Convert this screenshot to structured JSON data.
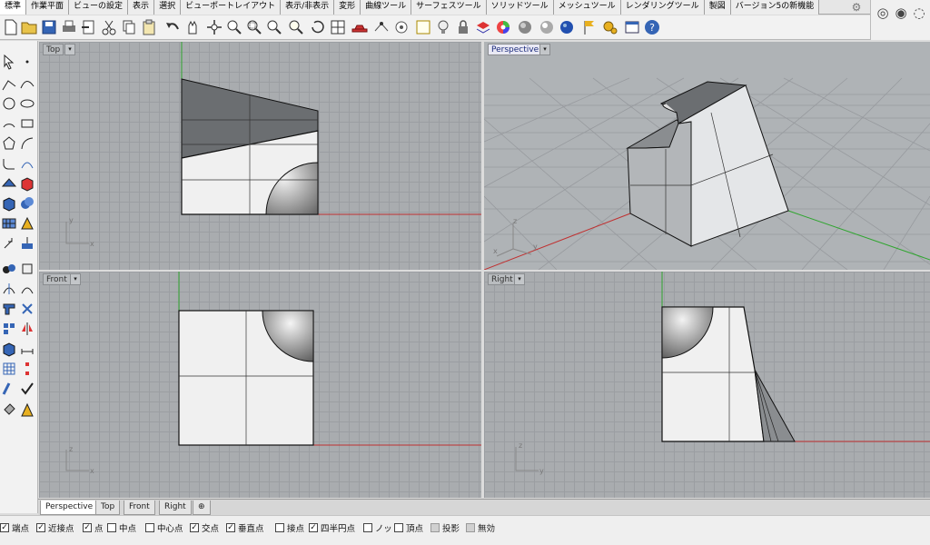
{
  "ribbon_tabs": [
    "標準",
    "作業平面",
    "ビューの設定",
    "表示",
    "選択",
    "ビューポートレイアウト",
    "表示/非表示",
    "変形",
    "曲線ツール",
    "サーフェスツール",
    "ソリッドツール",
    "メッシュツール",
    "レンダリングツール",
    "製図",
    "バージョン5の新機能"
  ],
  "viewports": {
    "top": {
      "title": "Top",
      "menu": "▾",
      "axis_labels": [
        "y",
        "x"
      ]
    },
    "perspective": {
      "title": "Perspective",
      "menu": "▾",
      "axis_labels": [
        "z",
        "y",
        "x"
      ]
    },
    "front": {
      "title": "Front",
      "menu": "▾",
      "axis_labels": [
        "z",
        "x"
      ]
    },
    "right": {
      "title": "Right",
      "menu": "▾",
      "axis_labels": [
        "z",
        "y"
      ]
    }
  },
  "viewport_tabs": [
    "Perspective",
    "Top",
    "Front",
    "Right"
  ],
  "add_tab_label": "⊕",
  "osnaps": [
    {
      "label": "端点",
      "checked": true,
      "enabled": true
    },
    {
      "label": "近接点",
      "checked": true,
      "enabled": true
    },
    {
      "label": "点",
      "checked": true,
      "enabled": true
    },
    {
      "label": "中点",
      "checked": false,
      "enabled": true
    },
    {
      "label": "中心点",
      "checked": false,
      "enabled": true
    },
    {
      "label": "交点",
      "checked": true,
      "enabled": true
    },
    {
      "label": "垂直点",
      "checked": true,
      "enabled": true
    },
    {
      "label": "接点",
      "checked": false,
      "enabled": true
    },
    {
      "label": "四半円点",
      "checked": true,
      "enabled": true
    },
    {
      "label": "ノット",
      "checked": false,
      "enabled": true
    },
    {
      "label": "頂点",
      "checked": false,
      "enabled": true
    },
    {
      "label": "投影",
      "checked": false,
      "enabled": false
    },
    {
      "label": "無効",
      "checked": false,
      "enabled": false
    }
  ],
  "check_glyph": "✓",
  "colors": {
    "x_axis": "#c03030",
    "y_axis": "#2fa52f",
    "active_title": "#e9e9f4"
  }
}
